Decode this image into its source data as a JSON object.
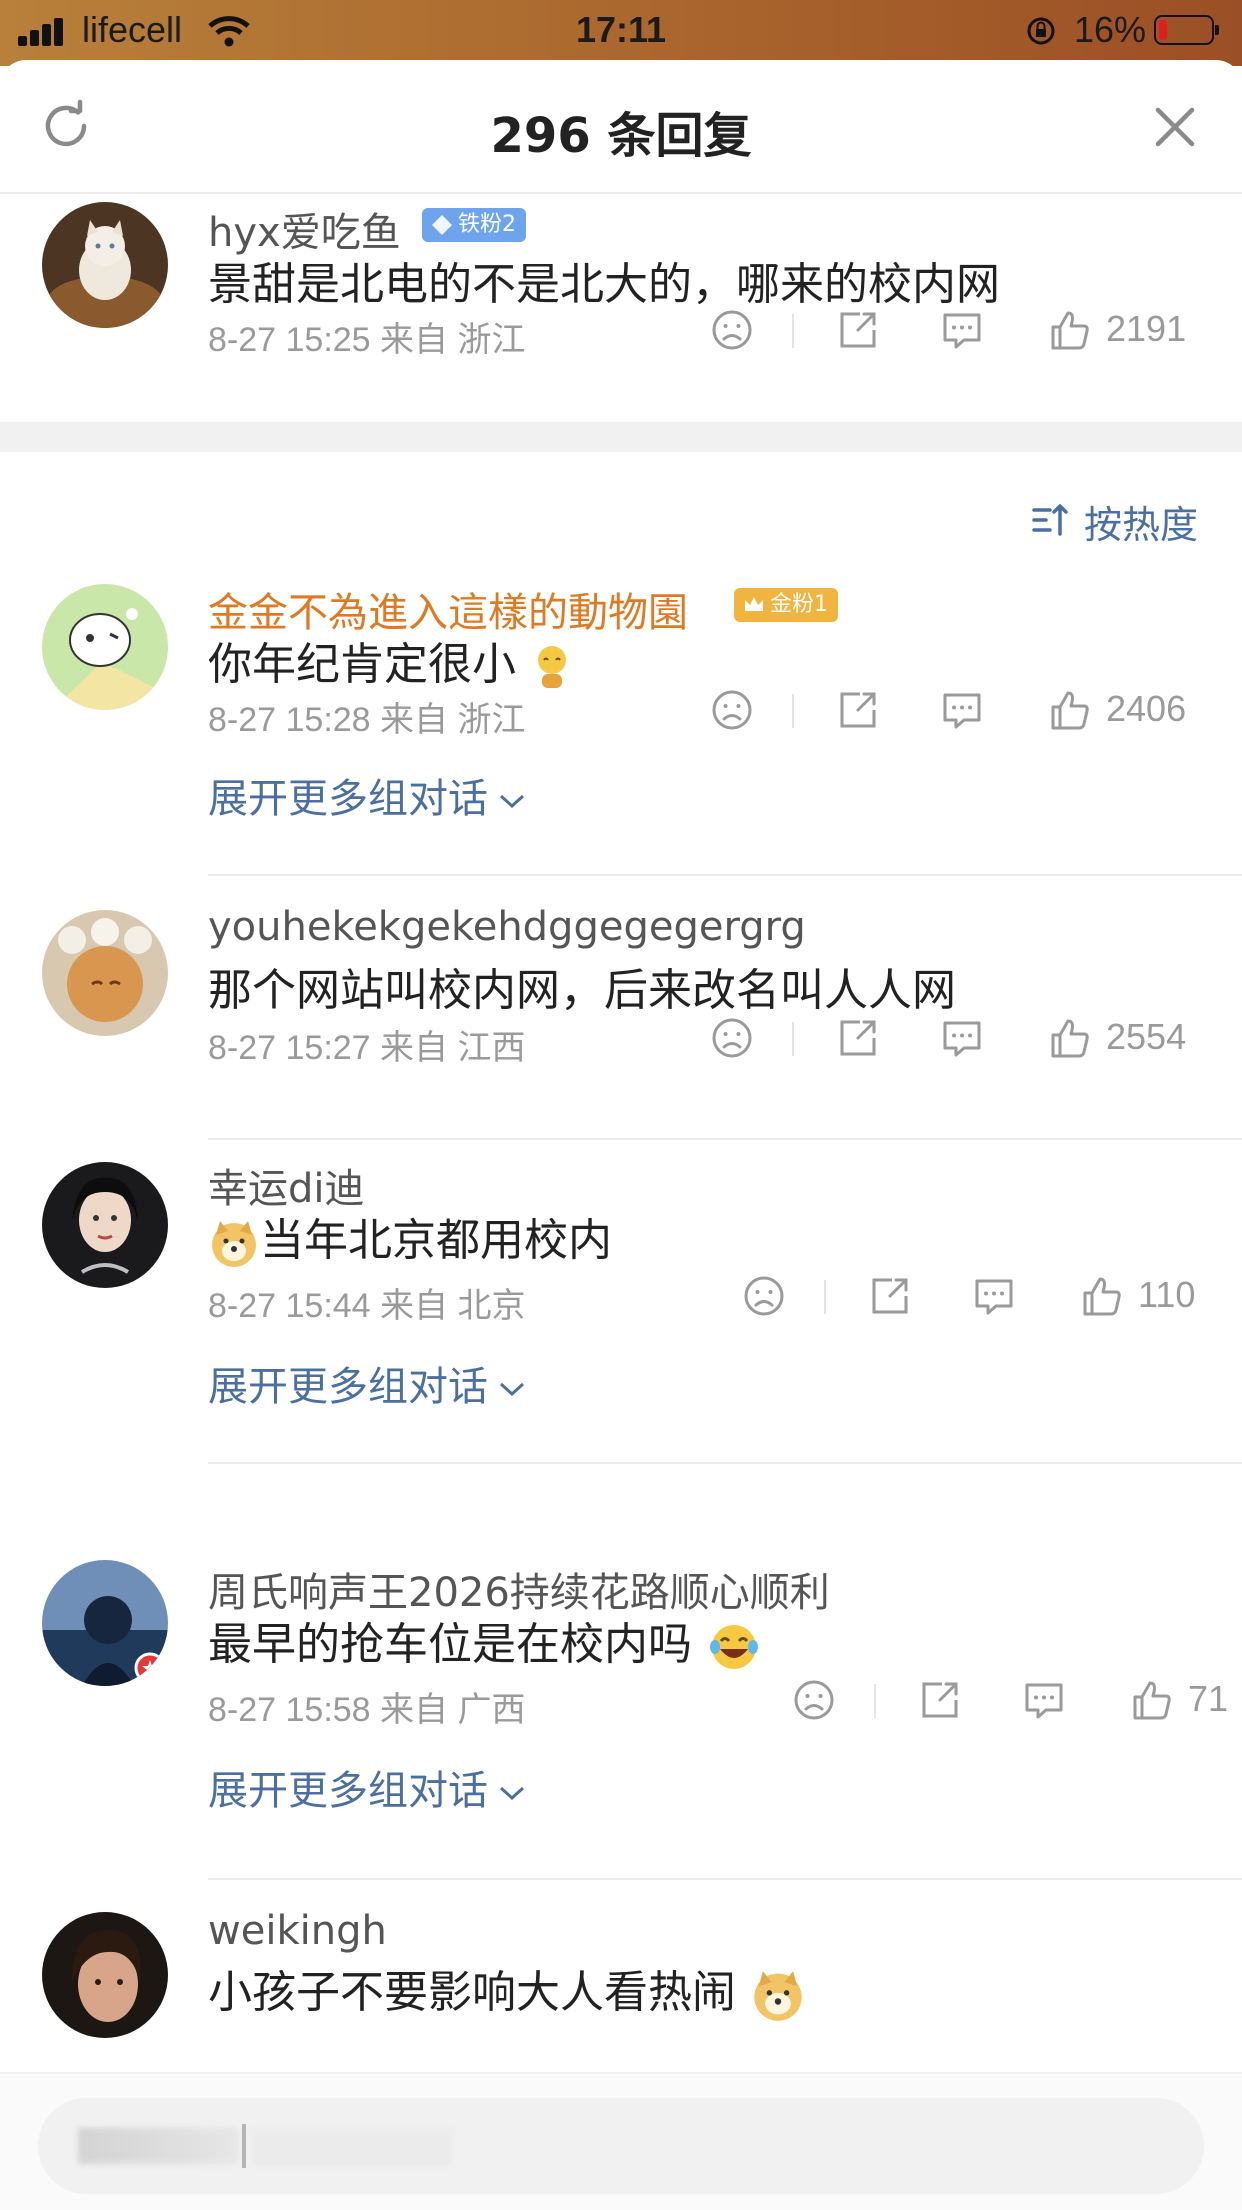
{
  "status_bar": {
    "carrier": "lifecell",
    "time": "17:11",
    "battery": "16%"
  },
  "header": {
    "title": "296 条回复"
  },
  "root_comment": {
    "user": "hyx爱吃鱼",
    "badge": "铁粉2",
    "text": "景甜是北电的不是北大的，哪来的校内网",
    "meta": "8-27 15:25 来自 浙江",
    "likes": "2191"
  },
  "sort": {
    "label": "按热度"
  },
  "comments": [
    {
      "user": "金金不為進入這樣的動物園",
      "badge": "金粉1",
      "text": "你年纪肯定很小",
      "meta": "8-27 15:28 来自 浙江",
      "likes": "2406",
      "expand": "展开更多组对话"
    },
    {
      "user": "youhekekgekehdggegegergrg",
      "text": "那个网站叫校内网，后来改名叫人人网",
      "meta": "8-27 15:27 来自 江西",
      "likes": "2554"
    },
    {
      "user": "幸运di迪",
      "text": "当年北京都用校内",
      "meta": "8-27 15:44 来自 北京",
      "likes": "110",
      "expand": "展开更多组对话"
    },
    {
      "user": "周氏响声王2026持续花路顺心顺利",
      "text": "最早的抢车位是在校内吗",
      "meta": "8-27 15:58 来自 广西",
      "likes": "71",
      "expand": "展开更多组对话"
    },
    {
      "user": "weikingh",
      "text": "小孩子不要影响大人看热闹"
    }
  ],
  "colors": {
    "link": "#4a6fa0",
    "gold_name": "#e07a22",
    "meta": "#9a9a9a"
  }
}
